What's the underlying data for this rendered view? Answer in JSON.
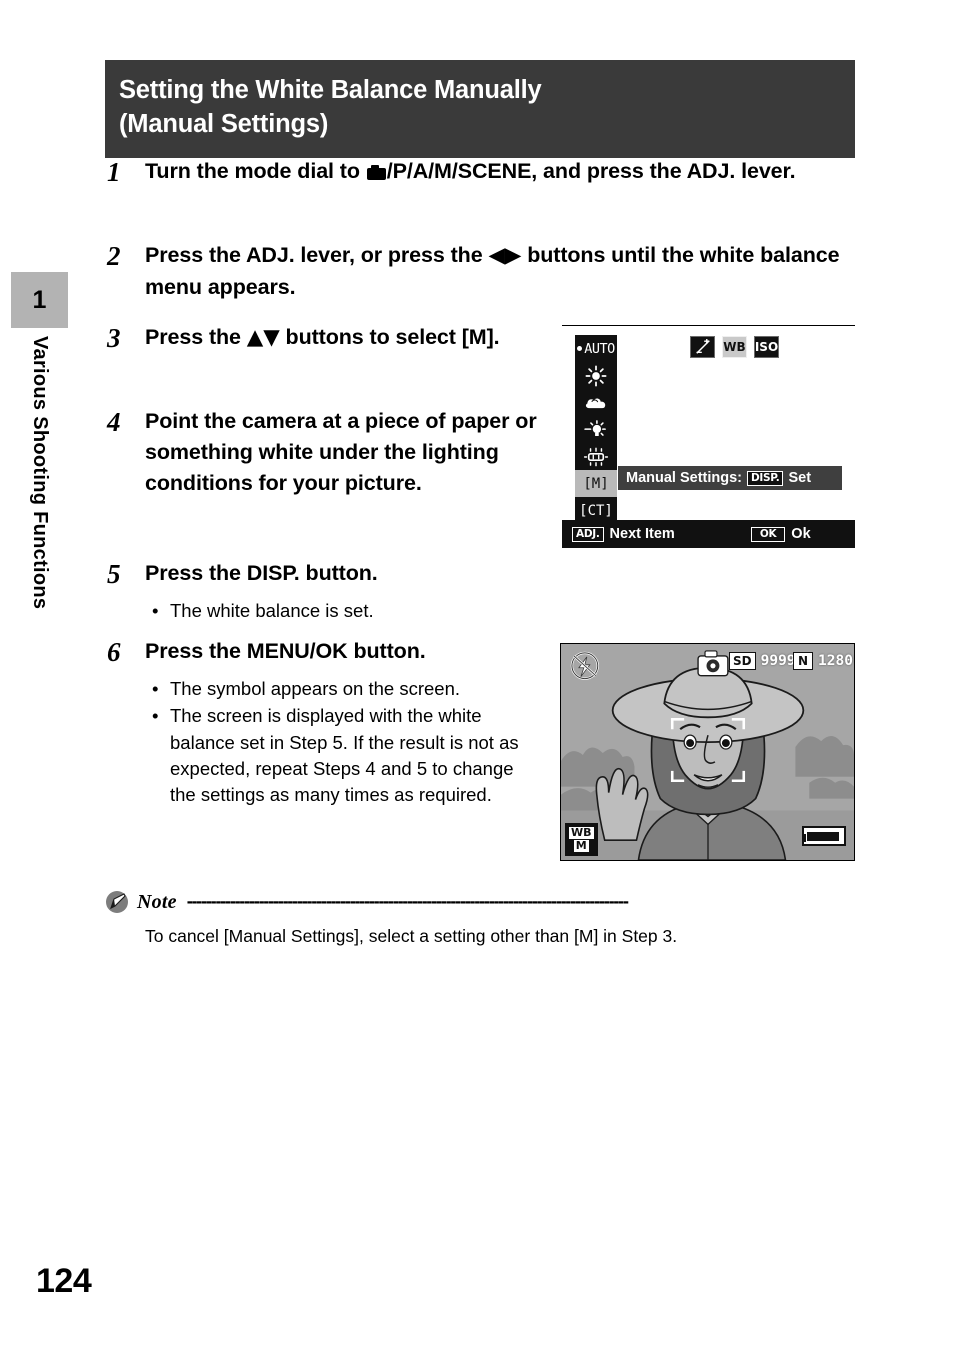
{
  "sidebar": {
    "chapter_number": "1",
    "chapter_label": "Various Shooting Functions"
  },
  "header": {
    "line1": "Setting the White Balance Manually",
    "line2": "(Manual Settings)"
  },
  "steps": [
    {
      "number": "1",
      "text_before_icon": "Turn the mode dial to ",
      "icon": "still-camera-mode-icon",
      "text_after_icon": "/P/A/M/SCENE, and press the ADJ. lever."
    },
    {
      "number": "2",
      "text_before_icon": "Press the ADJ. lever, or press the ",
      "icon": "left-right-arrows-icon",
      "icon_glyph": "◀▶",
      "text_after_icon": " buttons until the white balance menu appears."
    },
    {
      "number": "3",
      "text_before_icon": "Press the ",
      "icon": "up-down-arrows-icon",
      "icon_glyph": "▲▼",
      "text_after_icon": " buttons to select [M]."
    },
    {
      "number": "4",
      "text": "Point the camera at a piece of paper or something white under the lighting conditions for your picture."
    },
    {
      "number": "5",
      "text": "Press the DISP. button.",
      "bullets": [
        "The white balance is set."
      ]
    },
    {
      "number": "6",
      "text": "Press the MENU/OK button.",
      "bullets": [
        "The symbol appears on the screen.",
        "The screen is displayed with the white balance set in Step 5. If the result is not as expected, repeat Steps 4 and 5 to change the settings as many times as required."
      ]
    }
  ],
  "lcd_menu": {
    "wb_options": [
      {
        "label": "AUTO",
        "icon": "auto-wb-icon",
        "selected": false,
        "marked": true
      },
      {
        "label": "",
        "icon": "daylight-sun-icon",
        "selected": false
      },
      {
        "label": "",
        "icon": "overcast-cloud-icon",
        "selected": false
      },
      {
        "label": "",
        "icon": "incandescent-bulb-icon",
        "selected": false
      },
      {
        "label": "",
        "icon": "fluorescent-tube-icon",
        "selected": false
      },
      {
        "label": "[M]",
        "icon": "manual-wb-icon",
        "selected": true
      },
      {
        "label": "[CT]",
        "icon": "color-temperature-icon",
        "selected": false
      }
    ],
    "tabs": [
      {
        "label": "±",
        "icon": "exposure-compensation-icon",
        "active": false
      },
      {
        "label": "WB",
        "icon": "white-balance-icon",
        "active": true
      },
      {
        "label": "ISO",
        "icon": "iso-icon",
        "active": false
      }
    ],
    "manual_settings_bar": {
      "label": "Manual Settings:",
      "key": "DISP.",
      "action": "Set"
    },
    "bottom_bar": [
      {
        "key": "ADJ.",
        "action": "Next Item"
      },
      {
        "key": "OK",
        "action": "Ok"
      }
    ]
  },
  "lcd_preview": {
    "status": {
      "flash_icon": "flash-off-icon",
      "mode_icon": "still-image-mode-icon",
      "card_badge": "SD",
      "remaining_shots": "9999",
      "quality_badge": "N",
      "image_size": "1280"
    },
    "wb_indicator": {
      "line1": "WB",
      "line2": "M"
    },
    "battery_icon": "battery-full-icon",
    "af_frame": "af-target-frame"
  },
  "note": {
    "title": "Note",
    "dashes": "--------------------------------------------------------------------------------------------",
    "body": "To cancel [Manual Settings], select a setting other than [M] in Step 3."
  },
  "page": {
    "number": "124"
  },
  "colors": {
    "header_bg": "#3a3a3a",
    "sidebar_tab_bg": "#b3b3b3",
    "lcd_bg": "#111111",
    "selected_row": "#b9b9b9"
  }
}
